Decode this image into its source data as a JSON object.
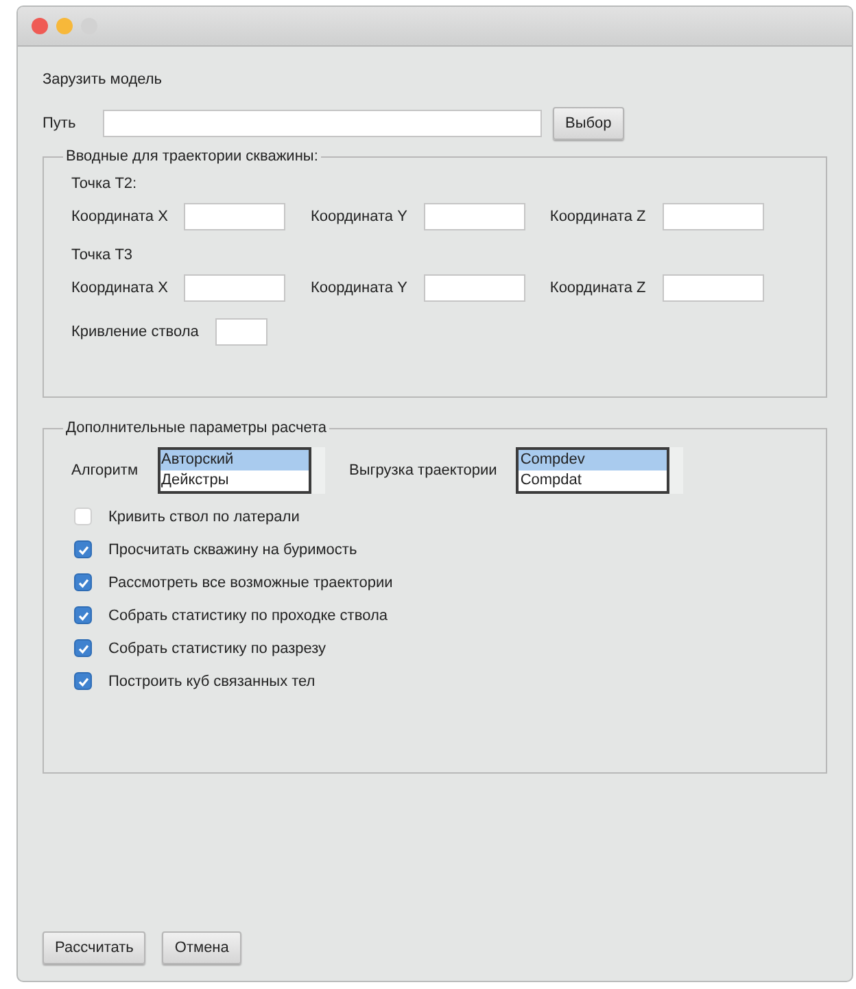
{
  "load_model": {
    "title": "Зарузить модель",
    "path_label": "Путь",
    "browse_button": "Выбор"
  },
  "trajectory_group": {
    "title": "Вводные для траектории скважины:",
    "points": [
      {
        "title": "Точка T2:",
        "fields": [
          {
            "label": "Координата X"
          },
          {
            "label": "Координата Y"
          },
          {
            "label": "Координата Z"
          }
        ]
      },
      {
        "title": "Точка T3",
        "fields": [
          {
            "label": "Координата X"
          },
          {
            "label": "Координата Y"
          },
          {
            "label": "Координата Z"
          }
        ]
      }
    ],
    "curvature_label": "Кривление ствола"
  },
  "params_group": {
    "title": "Дополнительные параметры расчета",
    "lists": [
      {
        "label": "Алгоритм",
        "items": [
          {
            "text": "Авторский",
            "selected": true
          },
          {
            "text": "Дейкстры",
            "selected": false
          }
        ]
      },
      {
        "label": "Выгрузка траектории",
        "items": [
          {
            "text": "Compdev",
            "selected": true
          },
          {
            "text": "Compdat",
            "selected": false
          }
        ]
      }
    ],
    "checkboxes": [
      {
        "label": "Кривить ствол по латерали",
        "checked": false
      },
      {
        "label": "Просчитать скважину на буримость",
        "checked": true
      },
      {
        "label": "Рассмотреть все возможные траектории",
        "checked": true
      },
      {
        "label": "Собрать статистику по проходке ствола",
        "checked": true
      },
      {
        "label": "Собрать статистику по разрезу",
        "checked": true
      },
      {
        "label": "Построить куб связанных тел",
        "checked": true
      }
    ]
  },
  "buttons": [
    "Рассчитать",
    "Отмена"
  ]
}
